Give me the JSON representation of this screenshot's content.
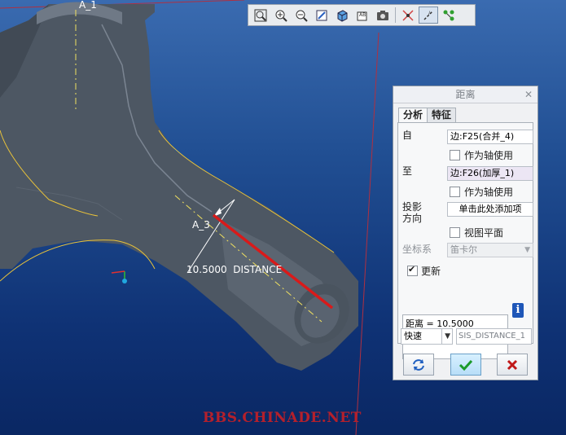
{
  "colors": {
    "accent_red": "#d91a1a",
    "watermark": "#b5202b",
    "model_fill": "#4d5763",
    "edge_yellow": "#e8c23a"
  },
  "viewport": {
    "axis_a1_label": "A_1",
    "axis_a3_label": "A_3",
    "dimension_label": "10.5000  DISTANCE",
    "watermark_text": "BBS.CHINADE.NET"
  },
  "toolbar": {
    "buttons": [
      {
        "name": "zoom-fit-icon"
      },
      {
        "name": "zoom-in-icon"
      },
      {
        "name": "zoom-out-icon"
      },
      {
        "name": "repaint-icon"
      },
      {
        "name": "shaded-view-icon"
      },
      {
        "name": "saved-views-icon"
      },
      {
        "name": "view-manager-icon"
      },
      {
        "name": "datum-planes-icon"
      },
      {
        "name": "datum-axes-icon"
      },
      {
        "name": "datum-points-icon"
      }
    ]
  },
  "dialog": {
    "title": "距离",
    "close_glyph": "✕",
    "tabs": [
      "分析",
      "特征"
    ],
    "from_label": "自",
    "from_value": "边:F25(合并_4)",
    "from_axis_label": "作为轴使用",
    "to_label": "至",
    "to_value": "边:F26(加厚_1)",
    "to_axis_label": "作为轴使用",
    "projection_label_1": "投影",
    "projection_label_2": "方向",
    "projection_value": "单击此处添加项",
    "view_plane_label": "视图平面",
    "csys_label": "坐标系",
    "csys_value": "笛卡尔",
    "update_label": "更新",
    "update_checked": true,
    "result_text": "距离 = 10.5000",
    "mode_value": "快速",
    "feature_name": "SIS_DISTANCE_1"
  }
}
